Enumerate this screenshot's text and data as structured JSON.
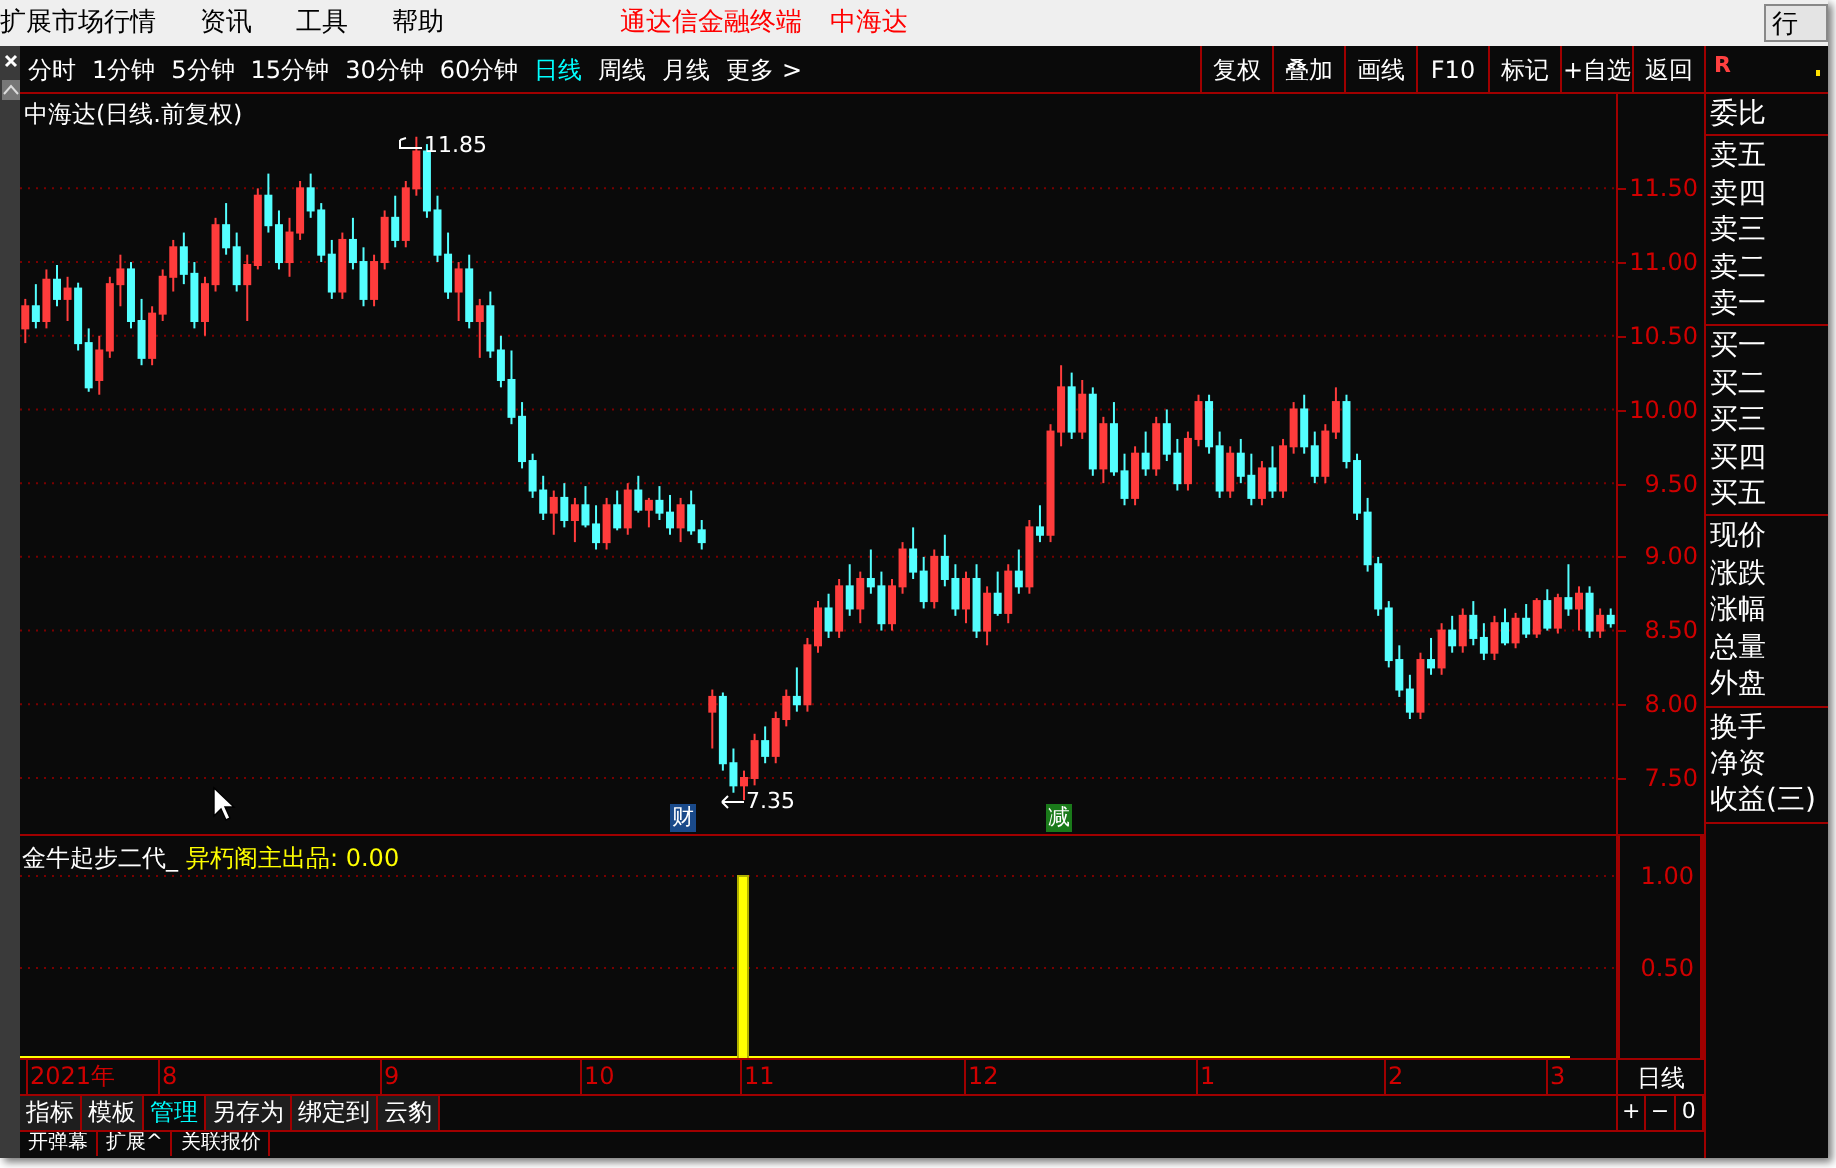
{
  "menu": [
    "扩展市场行情",
    "资讯",
    "工具",
    "帮助"
  ],
  "app_title": "通达信金融终端",
  "stock_title": "中海达",
  "corner_button": "行",
  "periods": [
    {
      "label": "分时",
      "selected": false
    },
    {
      "label": "1分钟",
      "selected": false
    },
    {
      "label": "5分钟",
      "selected": false
    },
    {
      "label": "15分钟",
      "selected": false
    },
    {
      "label": "30分钟",
      "selected": false
    },
    {
      "label": "60分钟",
      "selected": false
    },
    {
      "label": "日线",
      "selected": true
    },
    {
      "label": "周线",
      "selected": false
    },
    {
      "label": "月线",
      "selected": false
    },
    {
      "label": "更多 >",
      "selected": false
    }
  ],
  "tools": [
    "复权",
    "叠加",
    "画线",
    "F10",
    "标记",
    "+自选",
    "返回"
  ],
  "chart": {
    "title": "中海达(日线.前复权)",
    "high_label": "11.85",
    "low_label": "7.35",
    "chart_data": {
      "type": "candlestick",
      "grid": true,
      "ylim": [
        7.12,
        12.14
      ],
      "yticks": [
        {
          "value": 11.5,
          "label": "11.50"
        },
        {
          "value": 11,
          "label": "11.00"
        },
        {
          "value": 10.5,
          "label": "10.50"
        },
        {
          "value": 10,
          "label": "10.00"
        },
        {
          "value": 9.5,
          "label": "9.50"
        },
        {
          "value": 9,
          "label": "9.00"
        },
        {
          "value": 8.5,
          "label": "8.50"
        },
        {
          "value": 8,
          "label": "8.00"
        },
        {
          "value": 7.5,
          "label": "7.50"
        }
      ],
      "categories": [
        null,
        null,
        null,
        null,
        null,
        null,
        null,
        null,
        null,
        null,
        null,
        null,
        null,
        null,
        null,
        null,
        null,
        null,
        null,
        null,
        null,
        null,
        null,
        null,
        null,
        null,
        null,
        null,
        null,
        null,
        null,
        null,
        null,
        null,
        null,
        null,
        null,
        null,
        null,
        null,
        null,
        null,
        null,
        null,
        null,
        null,
        null,
        null,
        null,
        null,
        null,
        null,
        null,
        null,
        null,
        null,
        null,
        null,
        null,
        null,
        null,
        null,
        null,
        null,
        null,
        null,
        null,
        null,
        null,
        null,
        null,
        null,
        null,
        null,
        null,
        null,
        null,
        null,
        null,
        null,
        null,
        null,
        null,
        null,
        null,
        null,
        null,
        null,
        null,
        null,
        null,
        null,
        null,
        null,
        null,
        null,
        null,
        null,
        null,
        null,
        null,
        null,
        null,
        null,
        null,
        null,
        null,
        null,
        null,
        null,
        null,
        null,
        null,
        null,
        null,
        null,
        null,
        null,
        null,
        null,
        null,
        null,
        null,
        null,
        null,
        null,
        null,
        null,
        null,
        null,
        null,
        null,
        null,
        null,
        null,
        null,
        null,
        null,
        null,
        null,
        null,
        null,
        null,
        null,
        null,
        null,
        null,
        null,
        null,
        null,
        null
      ],
      "ohlc": [
        [
          10.55,
          10.75,
          10.45,
          10.7
        ],
        [
          10.7,
          10.85,
          10.55,
          10.6
        ],
        [
          10.6,
          10.95,
          10.55,
          10.88
        ],
        [
          10.88,
          10.98,
          10.7,
          10.75
        ],
        [
          10.75,
          10.9,
          10.6,
          10.82
        ],
        [
          10.82,
          10.86,
          10.4,
          10.45
        ],
        [
          10.45,
          10.55,
          10.12,
          10.15
        ],
        [
          10.2,
          10.5,
          10.1,
          10.4
        ],
        [
          10.4,
          10.9,
          10.35,
          10.85
        ],
        [
          10.85,
          11.05,
          10.7,
          10.95
        ],
        [
          10.95,
          11.0,
          10.55,
          10.6
        ],
        [
          10.6,
          10.75,
          10.3,
          10.35
        ],
        [
          10.35,
          10.7,
          10.3,
          10.65
        ],
        [
          10.65,
          10.95,
          10.6,
          10.9
        ],
        [
          10.9,
          11.15,
          10.8,
          11.1
        ],
        [
          11.1,
          11.2,
          10.85,
          10.92
        ],
        [
          10.92,
          11.0,
          10.55,
          10.6
        ],
        [
          10.6,
          10.9,
          10.5,
          10.85
        ],
        [
          10.85,
          11.3,
          10.8,
          11.25
        ],
        [
          11.25,
          11.4,
          11.05,
          11.1
        ],
        [
          11.1,
          11.2,
          10.8,
          10.85
        ],
        [
          10.85,
          11.05,
          10.6,
          10.98
        ],
        [
          10.98,
          11.5,
          10.95,
          11.45
        ],
        [
          11.45,
          11.6,
          11.2,
          11.25
        ],
        [
          11.25,
          11.35,
          10.95,
          11.0
        ],
        [
          11.0,
          11.3,
          10.9,
          11.2
        ],
        [
          11.2,
          11.55,
          11.15,
          11.5
        ],
        [
          11.5,
          11.6,
          11.3,
          11.35
        ],
        [
          11.35,
          11.4,
          11.0,
          11.05
        ],
        [
          11.05,
          11.15,
          10.75,
          10.8
        ],
        [
          10.8,
          11.2,
          10.75,
          11.15
        ],
        [
          11.15,
          11.3,
          10.95,
          11.0
        ],
        [
          11.0,
          11.1,
          10.7,
          10.75
        ],
        [
          10.75,
          11.05,
          10.7,
          11.0
        ],
        [
          11.0,
          11.35,
          10.95,
          11.3
        ],
        [
          11.3,
          11.45,
          11.1,
          11.15
        ],
        [
          11.15,
          11.55,
          11.1,
          11.5
        ],
        [
          11.5,
          11.85,
          11.45,
          11.75
        ],
        [
          11.75,
          11.8,
          11.3,
          11.35
        ],
        [
          11.35,
          11.45,
          11.0,
          11.05
        ],
        [
          11.05,
          11.2,
          10.75,
          10.8
        ],
        [
          10.8,
          11.0,
          10.6,
          10.95
        ],
        [
          10.95,
          11.05,
          10.55,
          10.6
        ],
        [
          10.6,
          10.75,
          10.35,
          10.7
        ],
        [
          10.7,
          10.8,
          10.35,
          10.4
        ],
        [
          10.4,
          10.5,
          10.15,
          10.2
        ],
        [
          10.2,
          10.4,
          9.9,
          9.95
        ],
        [
          9.95,
          10.05,
          9.6,
          9.65
        ],
        [
          9.65,
          9.7,
          9.4,
          9.45
        ],
        [
          9.45,
          9.55,
          9.25,
          9.3
        ],
        [
          9.3,
          9.45,
          9.15,
          9.4
        ],
        [
          9.4,
          9.5,
          9.2,
          9.25
        ],
        [
          9.25,
          9.4,
          9.1,
          9.35
        ],
        [
          9.35,
          9.48,
          9.2,
          9.22
        ],
        [
          9.22,
          9.35,
          9.05,
          9.1
        ],
        [
          9.1,
          9.4,
          9.05,
          9.35
        ],
        [
          9.35,
          9.45,
          9.18,
          9.2
        ],
        [
          9.2,
          9.5,
          9.15,
          9.45
        ],
        [
          9.45,
          9.55,
          9.3,
          9.32
        ],
        [
          9.32,
          9.4,
          9.2,
          9.38
        ],
        [
          9.38,
          9.48,
          9.25,
          9.3
        ],
        [
          9.3,
          9.42,
          9.15,
          9.2
        ],
        [
          9.2,
          9.4,
          9.1,
          9.35
        ],
        [
          9.35,
          9.45,
          9.15,
          9.18
        ],
        [
          9.18,
          9.25,
          9.05,
          9.1
        ],
        [
          7.95,
          8.1,
          7.7,
          8.05
        ],
        [
          8.05,
          8.08,
          7.55,
          7.6
        ],
        [
          7.6,
          7.7,
          7.4,
          7.45
        ],
        [
          7.45,
          7.55,
          7.35,
          7.5
        ],
        [
          7.5,
          7.8,
          7.45,
          7.75
        ],
        [
          7.75,
          7.85,
          7.6,
          7.65
        ],
        [
          7.65,
          7.95,
          7.6,
          7.9
        ],
        [
          7.9,
          8.1,
          7.85,
          8.05
        ],
        [
          8.05,
          8.25,
          7.95,
          8.0
        ],
        [
          8.0,
          8.45,
          7.95,
          8.4
        ],
        [
          8.4,
          8.7,
          8.35,
          8.65
        ],
        [
          8.65,
          8.75,
          8.45,
          8.5
        ],
        [
          8.5,
          8.85,
          8.45,
          8.8
        ],
        [
          8.8,
          8.95,
          8.6,
          8.65
        ],
        [
          8.65,
          8.9,
          8.55,
          8.85
        ],
        [
          8.85,
          9.05,
          8.75,
          8.8
        ],
        [
          8.8,
          8.9,
          8.5,
          8.55
        ],
        [
          8.55,
          8.85,
          8.5,
          8.8
        ],
        [
          8.8,
          9.1,
          8.75,
          9.05
        ],
        [
          9.05,
          9.2,
          8.85,
          8.9
        ],
        [
          8.9,
          9.0,
          8.65,
          8.7
        ],
        [
          8.7,
          9.05,
          8.65,
          9.0
        ],
        [
          9.0,
          9.15,
          8.8,
          8.85
        ],
        [
          8.85,
          8.95,
          8.6,
          8.65
        ],
        [
          8.65,
          8.9,
          8.55,
          8.85
        ],
        [
          8.85,
          8.95,
          8.45,
          8.5
        ],
        [
          8.5,
          8.8,
          8.4,
          8.75
        ],
        [
          8.75,
          8.9,
          8.6,
          8.62
        ],
        [
          8.62,
          8.95,
          8.55,
          8.9
        ],
        [
          8.9,
          9.05,
          8.75,
          8.8
        ],
        [
          8.8,
          9.25,
          8.75,
          9.2
        ],
        [
          9.2,
          9.35,
          9.1,
          9.15
        ],
        [
          9.15,
          9.9,
          9.1,
          9.85
        ],
        [
          9.85,
          10.3,
          9.75,
          10.15
        ],
        [
          10.15,
          10.25,
          9.8,
          9.85
        ],
        [
          9.85,
          10.2,
          9.8,
          10.1
        ],
        [
          10.1,
          10.15,
          9.55,
          9.6
        ],
        [
          9.6,
          9.95,
          9.5,
          9.9
        ],
        [
          9.9,
          10.05,
          9.55,
          9.58
        ],
        [
          9.58,
          9.7,
          9.35,
          9.4
        ],
        [
          9.4,
          9.75,
          9.35,
          9.7
        ],
        [
          9.7,
          9.85,
          9.55,
          9.6
        ],
        [
          9.6,
          9.95,
          9.55,
          9.9
        ],
        [
          9.9,
          10.0,
          9.65,
          9.7
        ],
        [
          9.7,
          9.8,
          9.45,
          9.5
        ],
        [
          9.5,
          9.85,
          9.45,
          9.8
        ],
        [
          9.8,
          10.1,
          9.75,
          10.05
        ],
        [
          10.05,
          10.1,
          9.7,
          9.75
        ],
        [
          9.75,
          9.85,
          9.4,
          9.45
        ],
        [
          9.45,
          9.75,
          9.4,
          9.7
        ],
        [
          9.7,
          9.8,
          9.5,
          9.55
        ],
        [
          9.55,
          9.7,
          9.35,
          9.4
        ],
        [
          9.4,
          9.65,
          9.35,
          9.6
        ],
        [
          9.6,
          9.75,
          9.4,
          9.45
        ],
        [
          9.45,
          9.8,
          9.4,
          9.75
        ],
        [
          9.75,
          10.05,
          9.7,
          10.0
        ],
        [
          10.0,
          10.1,
          9.7,
          9.75
        ],
        [
          9.75,
          9.85,
          9.5,
          9.55
        ],
        [
          9.55,
          9.9,
          9.5,
          9.85
        ],
        [
          9.85,
          10.15,
          9.8,
          10.05
        ],
        [
          10.05,
          10.1,
          9.6,
          9.65
        ],
        [
          9.65,
          9.7,
          9.25,
          9.3
        ],
        [
          9.3,
          9.4,
          8.9,
          8.95
        ],
        [
          8.95,
          9.0,
          8.6,
          8.65
        ],
        [
          8.65,
          8.7,
          8.25,
          8.3
        ],
        [
          8.3,
          8.4,
          8.05,
          8.1
        ],
        [
          8.1,
          8.2,
          7.9,
          7.95
        ],
        [
          7.95,
          8.35,
          7.9,
          8.3
        ],
        [
          8.3,
          8.45,
          8.2,
          8.25
        ],
        [
          8.25,
          8.55,
          8.2,
          8.5
        ],
        [
          8.5,
          8.6,
          8.35,
          8.4
        ],
        [
          8.4,
          8.65,
          8.35,
          8.6
        ],
        [
          8.6,
          8.7,
          8.4,
          8.45
        ],
        [
          8.45,
          8.55,
          8.3,
          8.35
        ],
        [
          8.35,
          8.6,
          8.3,
          8.55
        ],
        [
          8.55,
          8.65,
          8.4,
          8.42
        ],
        [
          8.42,
          8.62,
          8.38,
          8.58
        ],
        [
          8.58,
          8.68,
          8.45,
          8.48
        ],
        [
          8.48,
          8.72,
          8.45,
          8.7
        ],
        [
          8.7,
          8.78,
          8.5,
          8.52
        ],
        [
          8.52,
          8.75,
          8.48,
          8.72
        ],
        [
          8.72,
          8.95,
          8.6,
          8.65
        ],
        [
          8.65,
          8.8,
          8.5,
          8.75
        ],
        [
          8.75,
          8.8,
          8.45,
          8.5
        ],
        [
          8.5,
          8.65,
          8.45,
          8.6
        ],
        [
          8.6,
          8.65,
          8.52,
          8.55
        ]
      ]
    },
    "events": [
      {
        "label": "财",
        "kind": "finance"
      },
      {
        "label": "减",
        "kind": "reduce"
      }
    ]
  },
  "indicator": {
    "name": "金牛起步二代_",
    "output": "异朽阁主出品: 0.00",
    "ticks": [
      "1.00",
      "0.50"
    ]
  },
  "date_axis": {
    "labels": [
      "2021年",
      "8",
      "9",
      "10",
      "11",
      "12",
      "1",
      "2",
      "3"
    ],
    "period": "日线"
  },
  "quote_panel": {
    "badge": "R",
    "groups": [
      [
        "委比"
      ],
      [
        "卖五",
        "卖四",
        "卖三",
        "卖二",
        "卖一"
      ],
      [
        "买一",
        "买二",
        "买三",
        "买四",
        "买五"
      ],
      [
        "现价",
        "涨跌",
        "涨幅",
        "总量",
        "外盘"
      ],
      [
        "换手",
        "净资",
        "收益(三)"
      ]
    ]
  },
  "bottom_tabs": [
    {
      "label": "指标",
      "selected": false
    },
    {
      "label": "模板",
      "selected": false
    },
    {
      "label": "管理",
      "selected": true
    },
    {
      "label": "另存为",
      "selected": false
    },
    {
      "label": "绑定到",
      "selected": false
    },
    {
      "label": "云豹",
      "selected": false
    }
  ],
  "zoom_buttons": [
    "+",
    "−",
    "0"
  ],
  "extra_tabs": [
    "开弹幕",
    "扩展^",
    "关联报价"
  ]
}
